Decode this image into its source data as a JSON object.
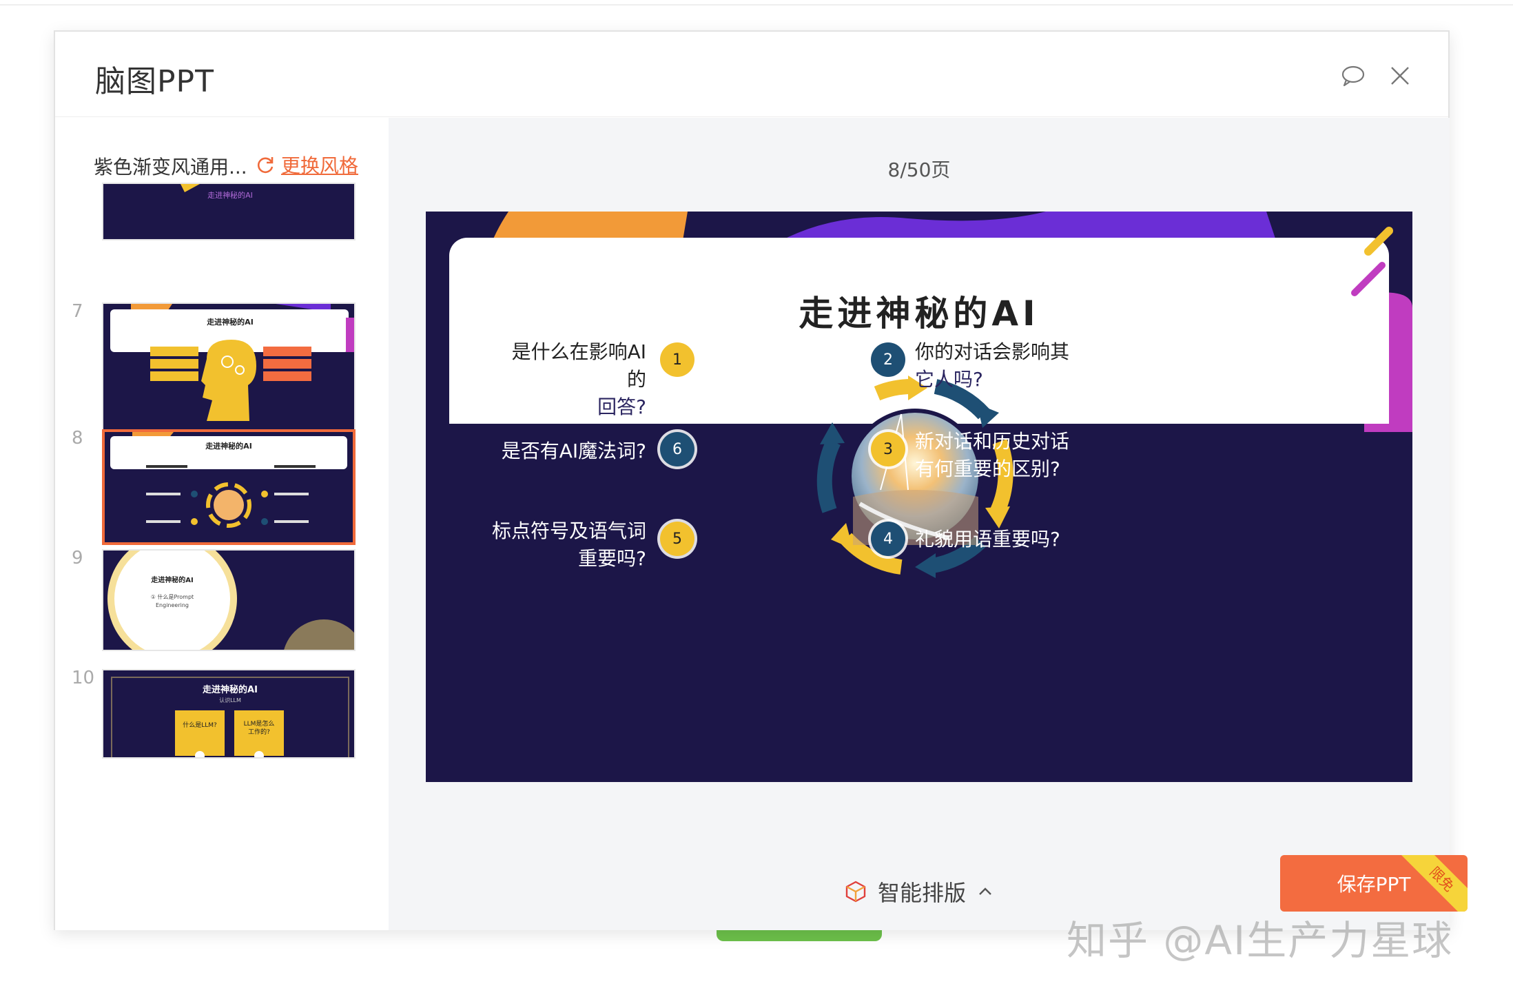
{
  "dialog": {
    "title": "脑图PPT",
    "icons": {
      "comment": "comment-icon",
      "close": "close-icon"
    }
  },
  "sidebar": {
    "template_name": "紫色渐变风通用...",
    "change_style_label": "更换风格",
    "thumbs": [
      {
        "number": "",
        "title": "走进神秘的AI"
      },
      {
        "number": "7",
        "title": "走进神秘的AI"
      },
      {
        "number": "8",
        "title": "走进神秘的AI"
      },
      {
        "number": "9",
        "title": "走进神秘的AI",
        "sub1": "① 什么是Prompt",
        "sub2": "Engineering"
      },
      {
        "number": "10",
        "title": "走进神秘的AI",
        "subtitle": "认识LLM",
        "box1": "什么是LLM?",
        "box2a": "LLM是怎么",
        "box2b": "工作的?"
      }
    ]
  },
  "main": {
    "pager": "8/50页",
    "slide": {
      "title": "走进神秘的AI",
      "items": [
        {
          "num": "1",
          "line1": "是什么在影响AI的",
          "line2": "回答?"
        },
        {
          "num": "2",
          "line1": "你的对话会影响其",
          "line2": "它人吗?"
        },
        {
          "num": "3",
          "line1": "新对话和历史对话",
          "line2": "有何重要的区别?"
        },
        {
          "num": "4",
          "line1": "礼貌用语重要吗?"
        },
        {
          "num": "5",
          "line1": "标点符号及语气词",
          "line2": "重要吗?"
        },
        {
          "num": "6",
          "line1": "是否有AI魔法词?"
        }
      ]
    },
    "smart_layout_label": "智能排版",
    "save_label": "保存PPT",
    "save_badge": "限免"
  },
  "watermark": "知乎 @AI生产力星球",
  "colors": {
    "accent": "#f36c40",
    "slide_bg": "#1c1648",
    "yellow": "#f2c12e",
    "navy": "#1e4f74",
    "purple": "#6b2ed6",
    "orange": "#f29a38"
  }
}
